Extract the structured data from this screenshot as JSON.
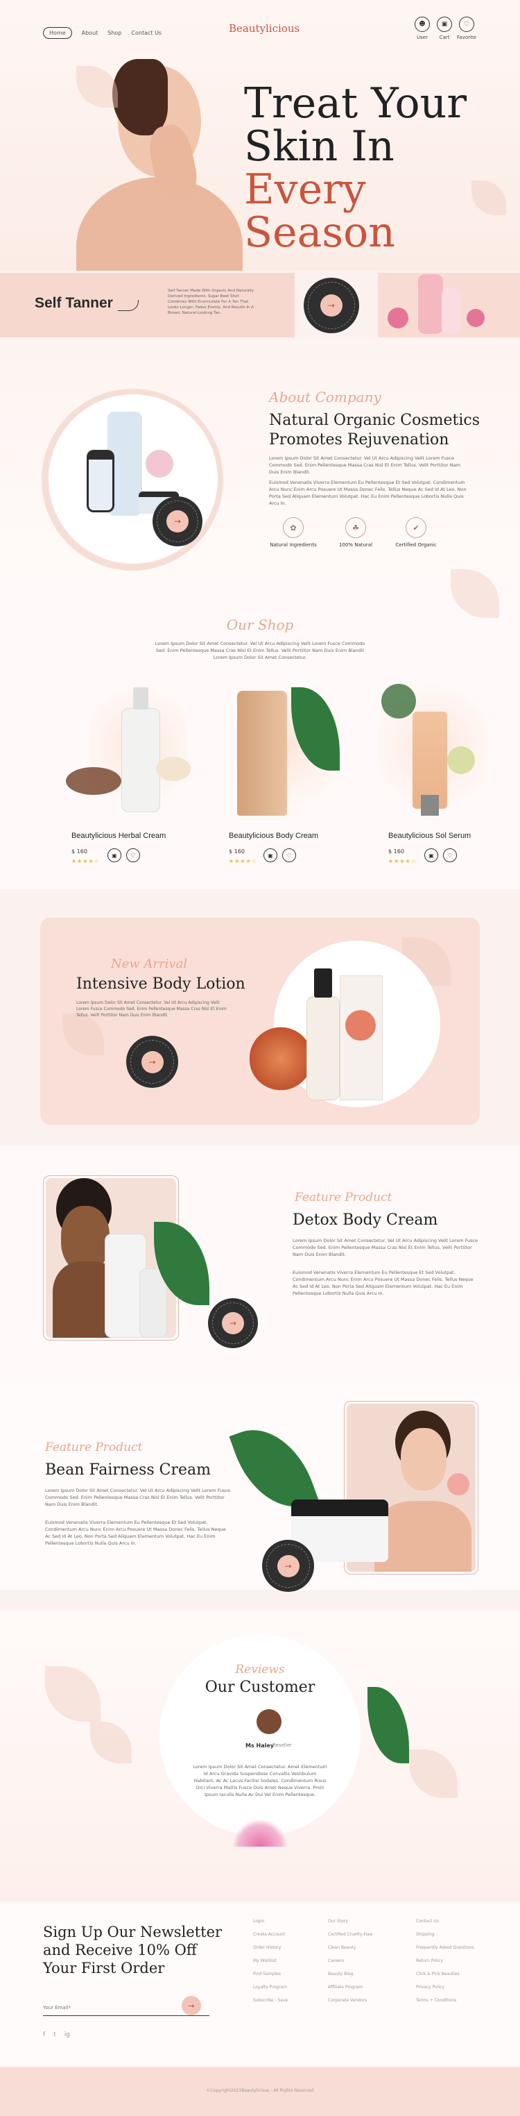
{
  "header": {
    "nav": [
      "Home",
      "About",
      "Shop",
      "Contact Us"
    ],
    "brand": "Beautylicious",
    "icons": [
      {
        "icon": "user-icon",
        "label": "User"
      },
      {
        "icon": "cart-icon",
        "label": "Cart"
      },
      {
        "icon": "heart-icon",
        "label": "Favorite"
      }
    ]
  },
  "hero": {
    "title_line1": "Treat Your",
    "title_line2a": "Skin In ",
    "title_line2b": "Every",
    "title_line3": "Season"
  },
  "self_tanner": {
    "title": "Self Tanner",
    "text": "Self Tanner Made With Organic And Naturally Derived Ingredients. Sugar Beet Shot Combines With Ecomsulate For A Tan That Looks Longer, Fades Evenly, And Results In A Brown, Natural-Looking Tan.",
    "badge": "SHOP NOW"
  },
  "about": {
    "script": "About Company",
    "title_line1": "Natural Organic Cosmetics",
    "title_line2": "Promotes Rejuvenation",
    "p1": "Lorem Ipsum Dolor Sit Amet Consectetur. Vel Ut Arcu Adipiscing Velit Lorem Fusce Commodo Sed. Enim Pellentesque Massa Cras Nisl Et Enim Tellus. Velit Porttitor Nam Duis Enim Blandit.",
    "p2": "Euismod Venenatis Viverra Elementum Eu Pellentesque Et Sed Volutpat. Condimentum Arcu Nunc Enim Arcu Posuere Ut Massa Donec Felis. Tellus Neque Ac Sed Id At Leo. Non Porta Sed Aliquam Elementum Volutpat. Hac Eu Enim Pellentesque Lobortis Nulla Quis Arcu In.",
    "features": [
      {
        "icon": "leaf-icon",
        "label": "Natural Ingredients"
      },
      {
        "icon": "organic-icon",
        "label": "100% Natural"
      },
      {
        "icon": "certified-icon",
        "label": "Certified Organic"
      }
    ],
    "badge": "SHOP NOW"
  },
  "shop": {
    "script": "Our Shop",
    "text": "Lorem Ipsum Dolor Sit Amet Consectetur. Vel Ut Arcu Adipiscing Velit Lorem Fusce Commodo Sed. Enim Pellentesque Massa Cras Nisl Et Enim Tellus. Velit Porttitor Nam Duis Enim Blandit Lorem Ipsum Dolor Sit Amet Consectetur.",
    "products": [
      {
        "name": "Beautylicious Herbal Cream",
        "price": "$ 160",
        "stars": "★★★★☆"
      },
      {
        "name": "Beautylicious Body Cream",
        "price": "$ 160",
        "stars": "★★★★☆"
      },
      {
        "name": "Beautylicious Sol Serum",
        "price": "$ 160",
        "stars": "★★★★☆"
      }
    ]
  },
  "arrival": {
    "script": "New Arrival",
    "title": "Intensive Body Lotion",
    "text": "Lorem Ipsum Dolor Sit Amet Consectetur. Vel Ut Arcu Adipiscing Velit Lorem Fusce Commodo Sed. Enim Pellentesque Massa Cras Nisl Et Enim Tellus. Velit Porttitor Nam Duis Enim Blandit.",
    "badge": "SHOP NOW"
  },
  "detox": {
    "script": "Feature Product",
    "title": "Detox Body Cream",
    "p1": "Lorem Ipsum Dolor Sit Amet Consectetur. Vel Ut Arcu Adipiscing Velit Lorem Fusce Commodo Sed. Enim Pellentesque Massa Cras Nisl Et Enim Tellus. Velit Porttitor Nam Duis Enim Blandit.",
    "p2": "Euismod Venenatis Viverra Elementum Eu Pellentesque Et Sed Volutpat. Condimentum Arcu Nunc Enim Arcu Posuere Ut Massa Donec Felis. Tellus Neque Ac Sed Id At Leo. Non Porta Sed Aliquam Elementum Volutpat. Hac Eu Enim Pellentesque Lobortis Nulla Quis Arcu In.",
    "badge": "SHOP NOW"
  },
  "bean": {
    "script": "Feature Product",
    "title": "Bean Fairness Cream",
    "p1": "Lorem Ipsum Dolor Sit Amet Consectetur. Vel Ut Arcu Adipiscing Velit Lorem Fusce Commodo Sed. Enim Pellentesque Massa Cras Nisl Et Enim Tellus. Velit Porttitor Nam Duis Enim Blandit.",
    "p2": "Euismod Venenatis Viverra Elementum Eu Pellentesque Et Sed Volutpat. Condimentum Arcu Nunc Enim Arcu Posuere Ut Massa Donec Felis. Tellus Neque Ac Sed Id At Leo. Non Porta Sed Aliquam Elementum Volutpat. Hac Eu Enim Pellentesque Lobortis Nulla Quis Arcu In.",
    "badge": "SHOP NOW"
  },
  "reviews": {
    "script": "Reviews",
    "title": "Our Customer",
    "name": "Ms Haley",
    "role": "Reseller",
    "text": "Lorem Ipsum Dolor Sit Amet Consectetur. Amet Elementum Id Arcu Gravida Suspendisse Convallis Vestibulum Habitant. Ac Ac Lacus Facilisi Sodales. Condimentum Risus Orci Viverra Mattis Fusce Duis Amet Neque Viverra. Proin Ipsum Iaculis Nulla Ac Dui Vel Enim Pellentesque."
  },
  "newsletter": {
    "title_line1": "Sign Up Our Newsletter",
    "title_line2": "and Receive 10% Off",
    "title_line3": "Your First Order",
    "placeholder": "Your Email*",
    "social": [
      "f",
      "t",
      "ig"
    ]
  },
  "footer": {
    "col1": [
      "Login",
      "Create Account",
      "Order History",
      "My Wishlist",
      "Find Samples",
      "Loyalty Program",
      "Subscribe - Save"
    ],
    "col2": [
      "Our Story",
      "Certified Cruelty-Free",
      "Clean Beauty",
      "Careers",
      "Beauty Blog",
      "Affiliate Program",
      "Corporate Vendors"
    ],
    "col3": [
      "Contact Us",
      "Shipping",
      "Frequently Asked Questions",
      "Return Policy",
      "Click & Pick Beauties",
      "Privacy Policy",
      "Terms + Conditions"
    ],
    "copyright": "©Copyright2023Beautylicious - All Rights Reserved"
  },
  "colors": {
    "accent": "#c8553d",
    "pink": "#f6d8cf",
    "dark": "#2f2f2f"
  }
}
